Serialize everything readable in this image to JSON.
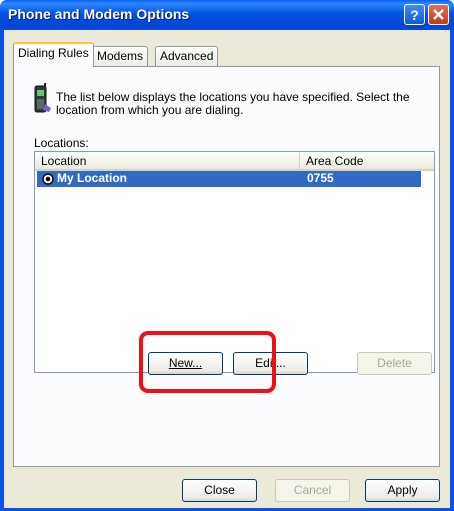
{
  "window": {
    "title": "Phone and Modem Options"
  },
  "tabs": [
    {
      "label": "Dialing Rules",
      "selected": true
    },
    {
      "label": "Modems",
      "selected": false
    },
    {
      "label": "Advanced",
      "selected": false
    }
  ],
  "dialing_rules": {
    "description": "The list below displays the locations you have specified. Select the location from which you are dialing.",
    "locations_label": "Locations:",
    "columns": [
      "Location",
      "Area Code"
    ],
    "rows": [
      {
        "location": "My Location",
        "area_code": "0755",
        "selected": true
      }
    ],
    "buttons": {
      "new": "New...",
      "edit": "Edit...",
      "delete": "Delete"
    }
  },
  "footer_buttons": {
    "close": "Close",
    "cancel": "Cancel",
    "apply": "Apply"
  },
  "colors": {
    "titlebar": "#0054e3",
    "selection": "#316ac5",
    "highlight": "#ee1111"
  }
}
